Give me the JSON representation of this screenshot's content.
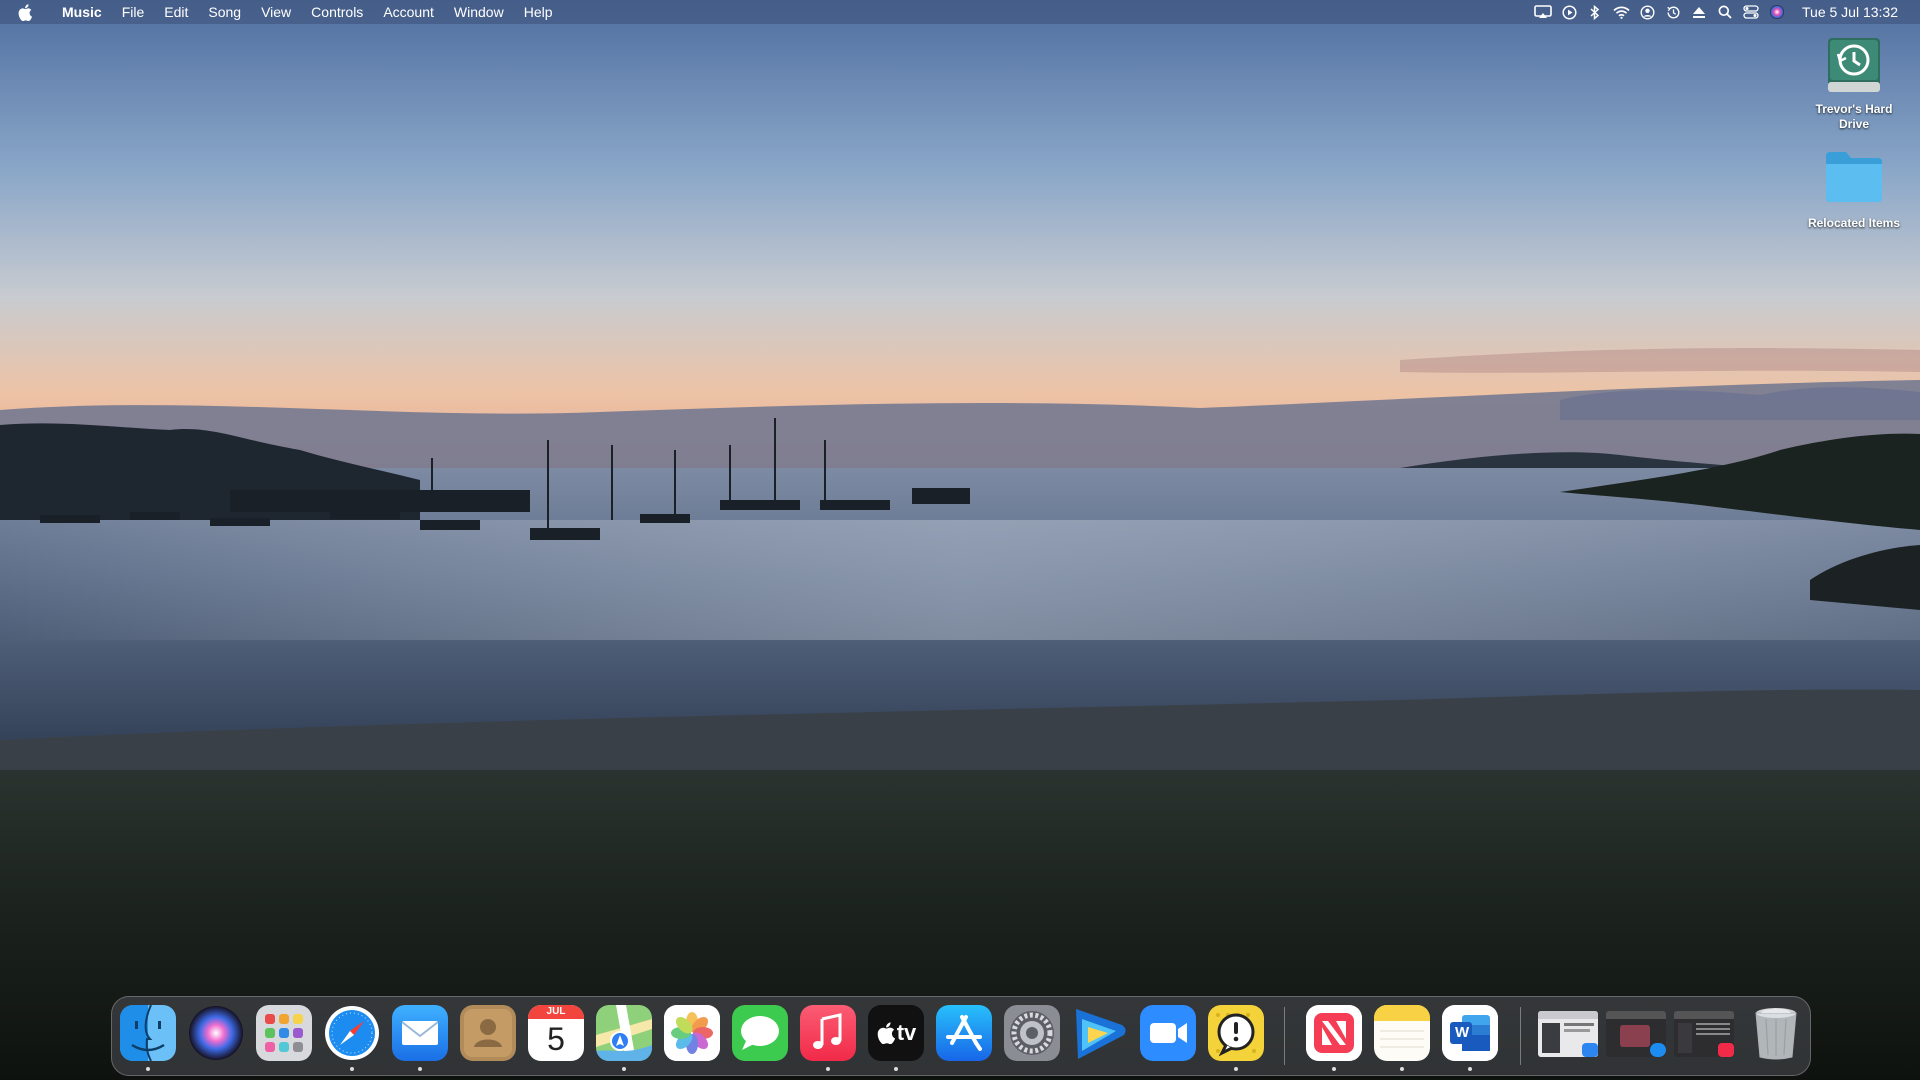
{
  "menubar": {
    "app_name": "Music",
    "items": [
      "File",
      "Edit",
      "Song",
      "View",
      "Controls",
      "Account",
      "Window",
      "Help"
    ],
    "clock": "Tue 5 Jul  13:32",
    "status_icons": [
      "screen-mirroring-icon",
      "play-circle-icon",
      "bluetooth-icon",
      "wifi-icon",
      "user-icon",
      "time-machine-icon",
      "eject-icon",
      "spotlight-search-icon",
      "control-center-icon",
      "siri-icon"
    ]
  },
  "desktop": {
    "icons": [
      {
        "name": "Trevor's Hard Drive",
        "icon": "time-machine-drive-icon"
      },
      {
        "name": "Relocated Items",
        "icon": "folder-icon"
      }
    ]
  },
  "dock": {
    "apps": [
      {
        "name": "Finder",
        "icon": "finder-icon",
        "running": true
      },
      {
        "name": "Siri",
        "icon": "siri-icon",
        "running": false
      },
      {
        "name": "Launchpad",
        "icon": "launchpad-icon",
        "running": false
      },
      {
        "name": "Safari",
        "icon": "safari-icon",
        "running": true
      },
      {
        "name": "Mail",
        "icon": "mail-icon",
        "running": true
      },
      {
        "name": "Contacts",
        "icon": "contacts-icon",
        "running": false
      },
      {
        "name": "Calendar",
        "icon": "calendar-icon",
        "running": false,
        "month": "JUL",
        "day": "5"
      },
      {
        "name": "Maps",
        "icon": "maps-icon",
        "running": true
      },
      {
        "name": "Photos",
        "icon": "photos-icon",
        "running": false
      },
      {
        "name": "Messages",
        "icon": "messages-icon",
        "running": false
      },
      {
        "name": "Music",
        "icon": "music-icon",
        "running": true
      },
      {
        "name": "TV",
        "icon": "apple-tv-icon",
        "running": true,
        "label": "tv"
      },
      {
        "name": "App Store",
        "icon": "app-store-icon",
        "running": false
      },
      {
        "name": "System Preferences",
        "icon": "system-preferences-icon",
        "running": false
      },
      {
        "name": "Infuse",
        "icon": "infuse-icon",
        "running": false
      },
      {
        "name": "Zoom",
        "icon": "zoom-icon",
        "running": false
      },
      {
        "name": "Console",
        "icon": "console-icon",
        "running": true
      },
      {
        "name": "News",
        "icon": "news-icon",
        "running": true
      },
      {
        "name": "Notes",
        "icon": "notes-icon",
        "running": true
      },
      {
        "name": "Word",
        "icon": "word-icon",
        "running": true,
        "label": "W"
      }
    ],
    "minimized": [
      {
        "name": "Mail window",
        "badge": "mail-badge-icon"
      },
      {
        "name": "Safari window",
        "badge": "safari-badge-icon"
      },
      {
        "name": "Music window",
        "badge": "music-badge-icon"
      }
    ],
    "trash": {
      "name": "Trash",
      "icon": "trash-icon"
    }
  }
}
